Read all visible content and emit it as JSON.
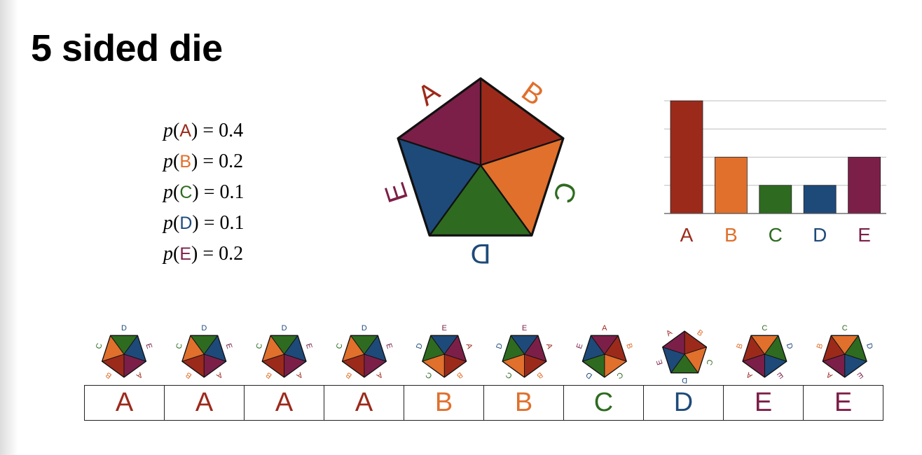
{
  "title": "5 sided die",
  "colors": {
    "A": "#9c2a1b",
    "B": "#e0702c",
    "C": "#2e6b20",
    "D": "#1e4a7a",
    "E": "#7c1f48"
  },
  "probabilities": [
    {
      "fn": "p",
      "label": "A",
      "value": "0.4"
    },
    {
      "fn": "p",
      "label": "B",
      "value": "0.2"
    },
    {
      "fn": "p",
      "label": "C",
      "value": "0.1"
    },
    {
      "fn": "p",
      "label": "D",
      "value": "0.1"
    },
    {
      "fn": "p",
      "label": "E",
      "value": "0.2"
    }
  ],
  "die": {
    "faces": [
      "A",
      "B",
      "C",
      "D",
      "E"
    ]
  },
  "chart_data": {
    "type": "bar",
    "categories": [
      "A",
      "B",
      "C",
      "D",
      "E"
    ],
    "values": [
      0.4,
      0.2,
      0.1,
      0.1,
      0.2
    ],
    "ylim": [
      0,
      0.4
    ],
    "grid": true,
    "title": "",
    "xlabel": "",
    "ylabel": ""
  },
  "samples": [
    {
      "label": "A",
      "rotation": 180
    },
    {
      "label": "A",
      "rotation": 180
    },
    {
      "label": "A",
      "rotation": 180
    },
    {
      "label": "A",
      "rotation": 180
    },
    {
      "label": "B",
      "rotation": 108
    },
    {
      "label": "B",
      "rotation": 108
    },
    {
      "label": "C",
      "rotation": 36
    },
    {
      "label": "D",
      "rotation": 0
    },
    {
      "label": "E",
      "rotation": -108
    },
    {
      "label": "E",
      "rotation": -108
    }
  ]
}
